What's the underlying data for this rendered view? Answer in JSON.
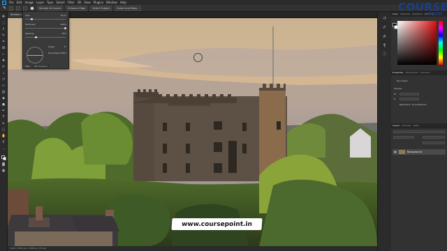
{
  "menu": {
    "items": [
      "File",
      "Edit",
      "Image",
      "Layer",
      "Type",
      "Select",
      "Filter",
      "3D",
      "View",
      "Plugins",
      "Window",
      "Help"
    ]
  },
  "options": {
    "mode_label": "Mode:",
    "mode_value": "Normal",
    "sample_label": "Sample All Layers",
    "enhance_label": "Enhance Edge",
    "subject_label": "Select Subject",
    "mask_label": "Select and Mask..."
  },
  "document": {
    "tab_label": "durham-castle.jpg @ 100% (RGB/8)",
    "status": "100%   |   1920 px x 1080 px (72 ppi)"
  },
  "brush_panel": {
    "size_label": "Size:",
    "size_value": "30 px",
    "hardness_label": "Hardness:",
    "hardness_value": "100%",
    "spacing_label": "Spacing:",
    "spacing_value": "25%",
    "angle_label": "Angle:",
    "angle_value": "0°",
    "roundness_label": "Roundness:",
    "roundness_value": "100%",
    "pressure_label": "Size:",
    "pressure_value": "Pen Pressure"
  },
  "color_panel": {
    "tabs": [
      "Color",
      "Swatches",
      "Gradients",
      "Patterns"
    ],
    "active_tab": "Color"
  },
  "properties_panel": {
    "tabs": [
      "Properties",
      "Adjustments",
      "Libraries"
    ],
    "doc_label": "Document",
    "canvas_label": "Canvas",
    "w_label": "W",
    "h_label": "H",
    "res_label": "Resolution: 72 pixels/inch"
  },
  "layers_panel": {
    "tabs": [
      "Layers",
      "Channels",
      "Paths"
    ],
    "layer_name": "Background"
  },
  "watermark": {
    "brand": "COURSE",
    "sub": "POINT"
  },
  "overlay": {
    "url": "www.coursepoint.in"
  },
  "colors": {
    "accent": "#31a8ff",
    "brand_blue": "#1a3f8a",
    "ui_dark": "#2b2b2b",
    "panel": "#323232"
  }
}
